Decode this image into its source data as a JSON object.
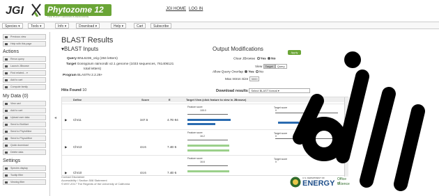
{
  "header": {
    "logo": "JGI",
    "product": "Phytozome",
    "version": "12",
    "subtitle": "THE PLANT GENOMICS RESOURCE",
    "links": [
      "JGI HOME",
      "LOG IN"
    ]
  },
  "menu": [
    {
      "label": "Species ▾"
    },
    {
      "label": "Tools ▾"
    },
    {
      "label": "Info ▾"
    },
    {
      "label": "Download ▾"
    },
    {
      "label": "Help ▾"
    },
    {
      "label": "Cart"
    },
    {
      "label": "Subscribe"
    }
  ],
  "sidebar": {
    "top_buttons": [
      "Previous view",
      "Help with this page"
    ],
    "actions_title": "Actions",
    "actions": [
      "Rerun query",
      "Launch JBrowse",
      "Find related... ▾",
      "Add to cart",
      "Compute family"
    ],
    "mydata_title": "My Data (0)",
    "mydata": [
      "View cart",
      "Add to cart",
      "Upload user data",
      "Send to BioMart",
      "Send to PhytoMine",
      "Send to PhycoMine",
      "Quick download",
      "Delete data"
    ],
    "settings_title": "Settings",
    "settings": [
      "Species display",
      "Tooltip filter",
      "Viewing filter"
    ]
  },
  "page_title": "BLAST Results",
  "inputs": {
    "title": "BLAST Inputs",
    "query_label": "Query",
    "query_value": "BNL6236_orig (284 letters)",
    "target_label": "Target",
    "target_value": "Gossypium raimondii v2.1 genome (1033 sequences, 761406121",
    "target_value2": "total letters)",
    "program_label": "Program",
    "program_value": "BLASTN 2.2.26+"
  },
  "mods": {
    "title": "Output Modifications",
    "apply": "Apply",
    "clear_label": "Clear JBrowse",
    "yes": "Yes",
    "no": "No",
    "view_label": "View",
    "view_target": "Target",
    "view_query": "Query",
    "overlap_label": "Allow Query Overlap",
    "intron_label": "Max Intron Size",
    "intron_value": "5000"
  },
  "hits": {
    "label": "Hits Found",
    "count": "10",
    "download_label": "Download results",
    "download_select": "Select BLAST format"
  },
  "table": {
    "headers": [
      "Define",
      "Score",
      "E",
      "Target View (click feature to view in JBrowse)"
    ],
    "rows": [
      {
        "define": "Chr11",
        "score": "347.5",
        "e": "4.7E-94",
        "fscore": "100.0",
        "tscore": "0"
      },
      {
        "define": "Chr13",
        "score": "44.6",
        "e": "7.4E-5",
        "fscore": "16.2",
        "tscore": "0"
      },
      {
        "define": "Chr10",
        "score": "44.6",
        "e": "7.4E-5",
        "fscore": "16.6",
        "tscore": "0"
      }
    ],
    "feature_label": "Feature score",
    "target_label": "Target score"
  },
  "footer": {
    "line1": "Contact   Disclaimer",
    "line2": "Accessibility / Section 508 Statement",
    "line3": "©1997-2017 The Regents of the University of California"
  },
  "energy": {
    "name": "ENERGY",
    "office": "Office of",
    "science": "Science",
    "dept": "U.S. DEPARTMENT OF"
  }
}
